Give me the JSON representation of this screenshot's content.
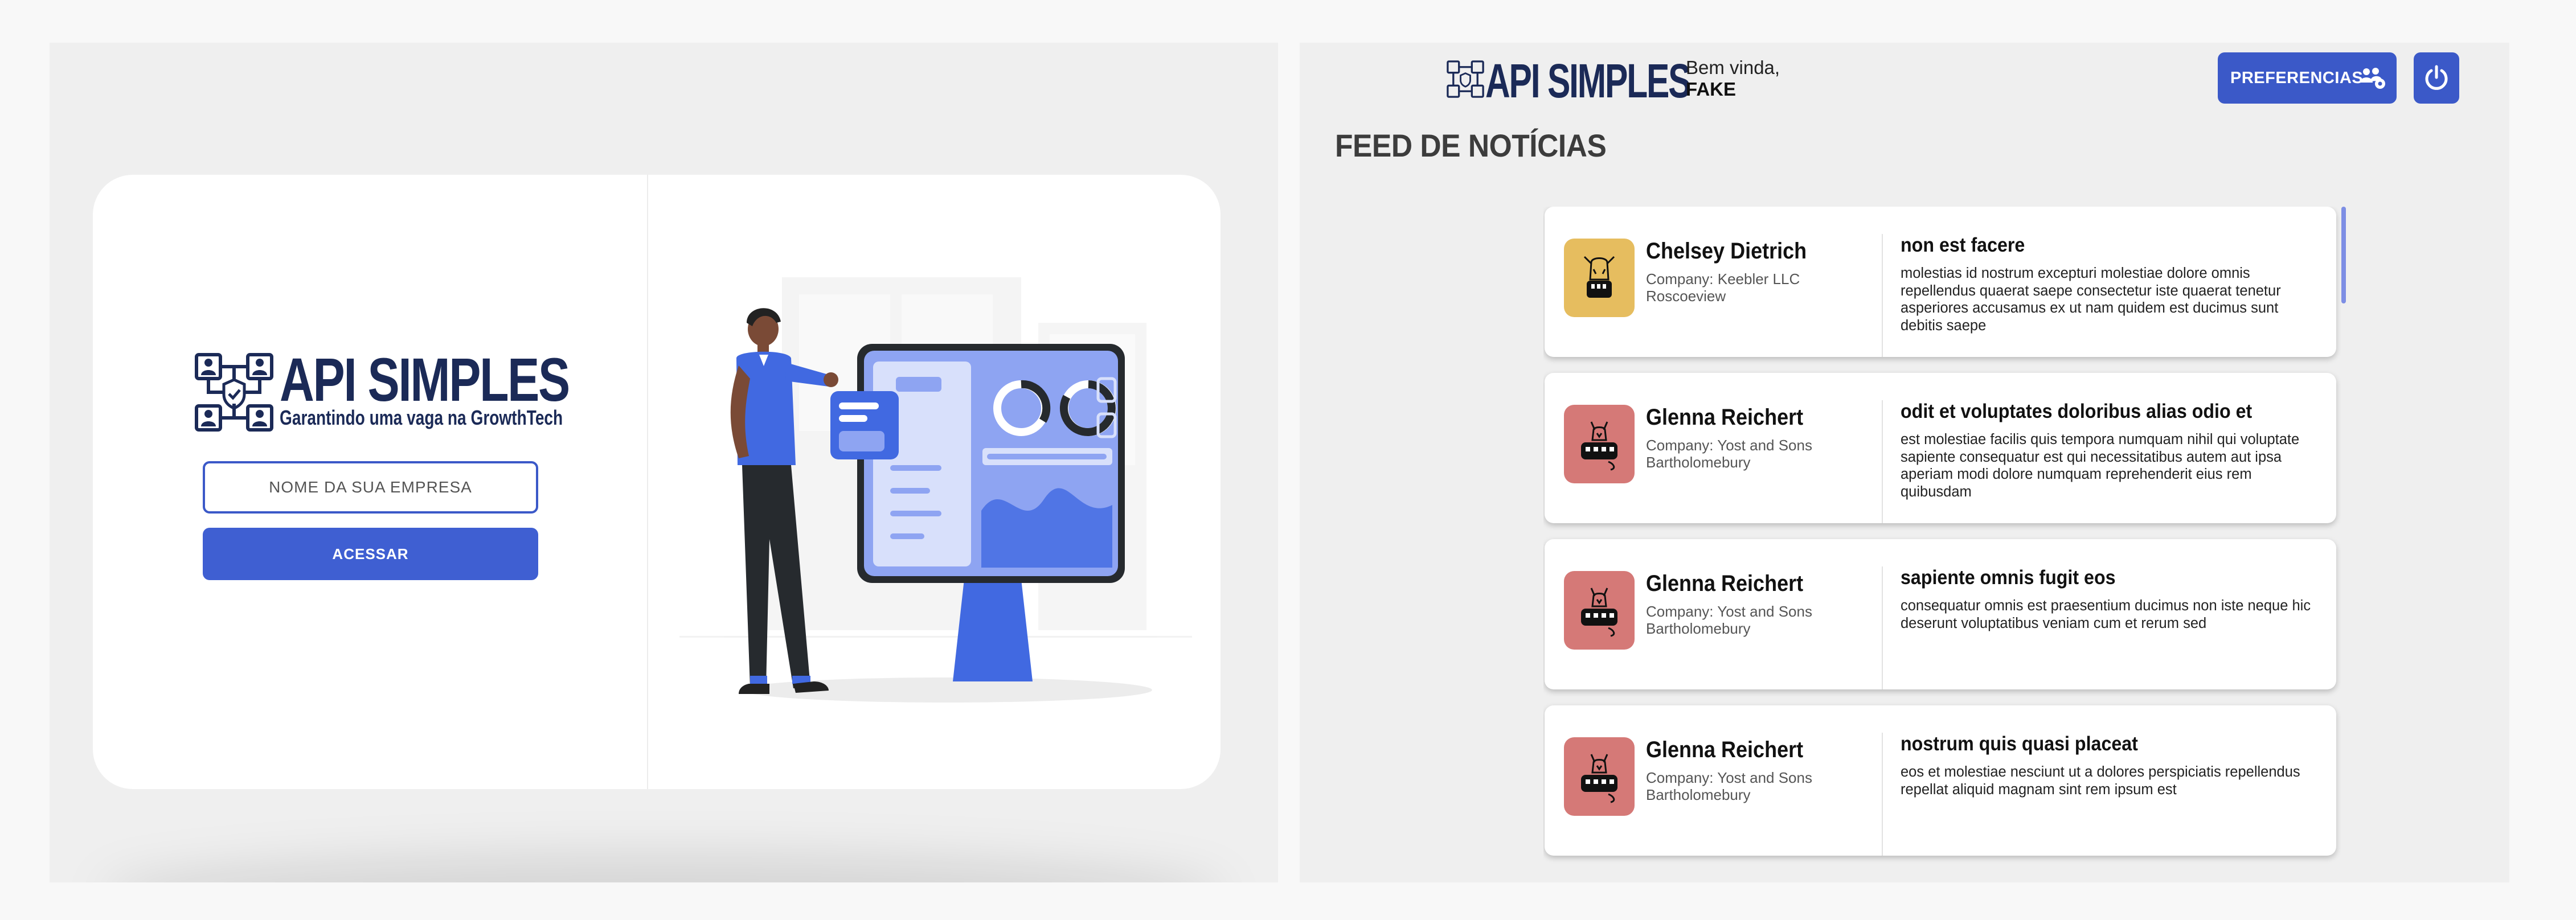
{
  "login": {
    "logo_title": "API SIMPLES",
    "logo_subtitle": "Garantindo uma vaga na GrowthTech",
    "company_placeholder": "NOME DA SUA EMPRESA",
    "access_label": "ACESSAR"
  },
  "header": {
    "logo_title": "API SIMPLES",
    "greeting": "Bem vinda,",
    "user_name": "FAKE",
    "preferences_label": "PREFERENCIAS",
    "logout_icon": "power-icon",
    "preferences_icon": "users-cog-icon"
  },
  "feed": {
    "title": "FEED DE NOTÍCIAS",
    "posts": [
      {
        "author": "Chelsey Dietrich",
        "company": "Company: Keebler LLC",
        "city": "Roscoeview",
        "title": "non est facere",
        "body": "molestias id nostrum excepturi molestiae dolore omnis repellendus quaerat saepe consectetur iste quaerat tenetur asperiores accusamus ex ut nam quidem est ducimus sunt debitis saepe",
        "avatar_color": "#e6bd5f"
      },
      {
        "author": "Glenna Reichert",
        "company": "Company: Yost and Sons",
        "city": "Bartholomebury",
        "title": "odit et voluptates doloribus alias odio et",
        "body": "est molestiae facilis quis tempora numquam nihil qui voluptate sapiente consequatur est qui necessitatibus autem aut ipsa aperiam modi dolore numquam reprehenderit eius rem quibusdam",
        "avatar_color": "#d57977"
      },
      {
        "author": "Glenna Reichert",
        "company": "Company: Yost and Sons",
        "city": "Bartholomebury",
        "title": "sapiente omnis fugit eos",
        "body": "consequatur omnis est praesentium ducimus non iste neque hic deserunt voluptatibus veniam cum et rerum sed",
        "avatar_color": "#d57977"
      },
      {
        "author": "Glenna Reichert",
        "company": "Company: Yost and Sons",
        "city": "Bartholomebury",
        "title": "nostrum quis quasi placeat",
        "body": "eos et molestiae nesciunt ut a dolores perspiciatis repellendus repellat aliquid magnam sint rem ipsum est",
        "avatar_color": "#d57977"
      }
    ]
  },
  "colors": {
    "primary": "#3b59c8",
    "logo_navy": "#1b2a57",
    "panel_bg": "#efefef"
  }
}
